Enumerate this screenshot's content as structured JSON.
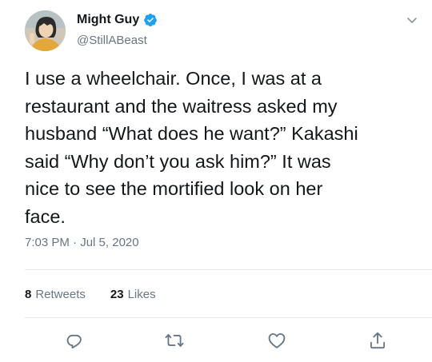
{
  "tweet": {
    "author": {
      "display_name": "Might Guy",
      "handle": "@StillABeast",
      "verified": true,
      "avatar_icon": "anime-avatar"
    },
    "text_lines": [
      "I use a wheelchair. Once, I was at a",
      "restaurant and the waitress asked my",
      "husband “What does he want?” Kakashi",
      "said “Why don’t you ask him?” It was",
      "nice to see the mortified look on her",
      "face."
    ],
    "time": "7:03 PM",
    "separator": "·",
    "date": "Jul 5, 2020",
    "stats": {
      "retweets_count": "8",
      "retweets_label": "Retweets",
      "likes_count": "23",
      "likes_label": "Likes"
    },
    "actions": [
      "reply-icon",
      "retweet-icon",
      "like-icon",
      "share-icon"
    ]
  },
  "colors": {
    "text": "#14171a",
    "secondary": "#657786",
    "verified": "#1da1f2",
    "divider": "#e1e8ed"
  }
}
